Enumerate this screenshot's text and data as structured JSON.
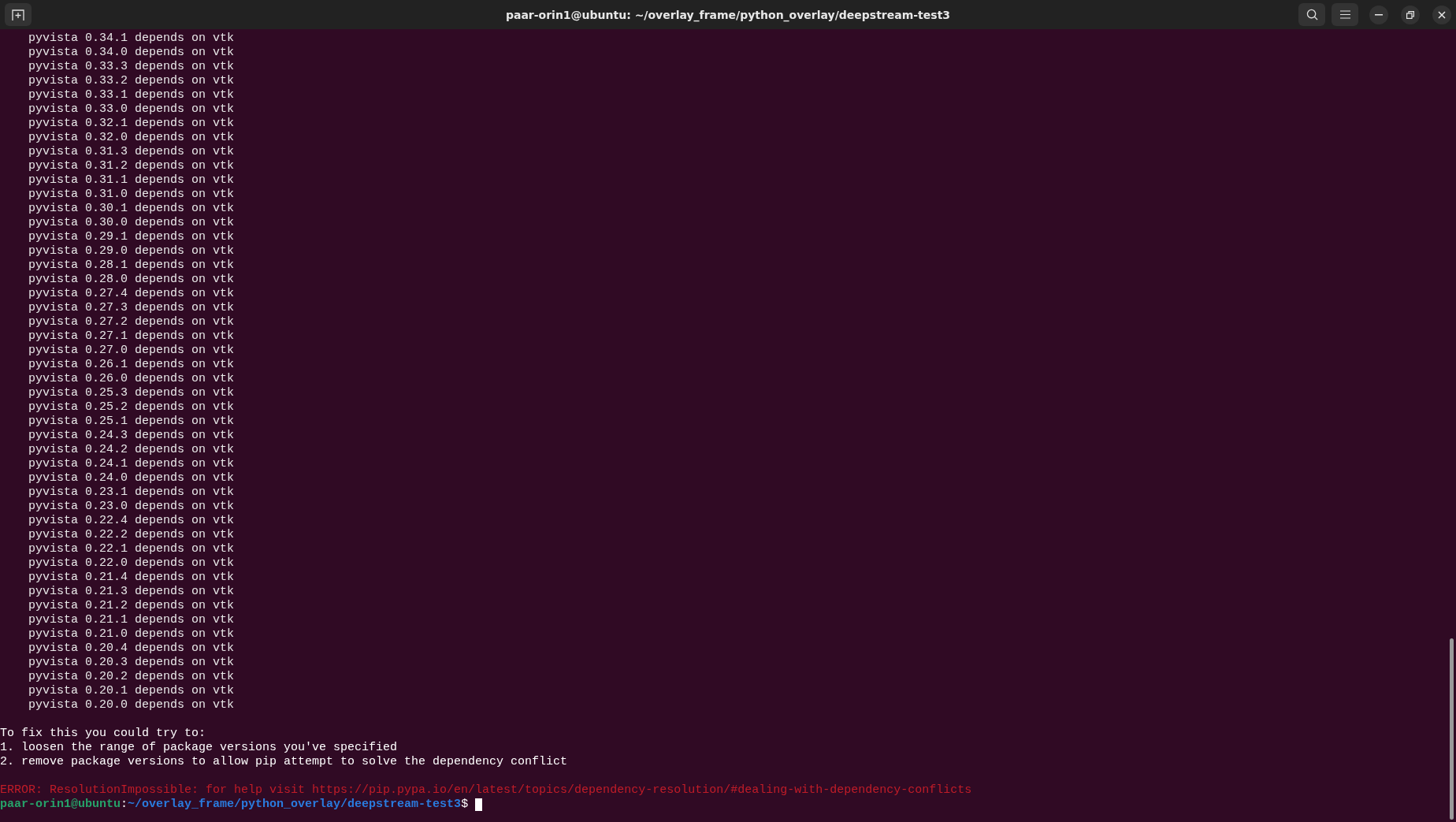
{
  "window": {
    "title": "paar-orin1@ubuntu: ~/overlay_frame/python_overlay/deepstream-test3"
  },
  "terminal": {
    "lines": [
      {
        "kind": "indented",
        "text": "pyvista 0.34.1 depends on vtk"
      },
      {
        "kind": "indented",
        "text": "pyvista 0.34.0 depends on vtk"
      },
      {
        "kind": "indented",
        "text": "pyvista 0.33.3 depends on vtk"
      },
      {
        "kind": "indented",
        "text": "pyvista 0.33.2 depends on vtk"
      },
      {
        "kind": "indented",
        "text": "pyvista 0.33.1 depends on vtk"
      },
      {
        "kind": "indented",
        "text": "pyvista 0.33.0 depends on vtk"
      },
      {
        "kind": "indented",
        "text": "pyvista 0.32.1 depends on vtk"
      },
      {
        "kind": "indented",
        "text": "pyvista 0.32.0 depends on vtk"
      },
      {
        "kind": "indented",
        "text": "pyvista 0.31.3 depends on vtk"
      },
      {
        "kind": "indented",
        "text": "pyvista 0.31.2 depends on vtk"
      },
      {
        "kind": "indented",
        "text": "pyvista 0.31.1 depends on vtk"
      },
      {
        "kind": "indented",
        "text": "pyvista 0.31.0 depends on vtk"
      },
      {
        "kind": "indented",
        "text": "pyvista 0.30.1 depends on vtk"
      },
      {
        "kind": "indented",
        "text": "pyvista 0.30.0 depends on vtk"
      },
      {
        "kind": "indented",
        "text": "pyvista 0.29.1 depends on vtk"
      },
      {
        "kind": "indented",
        "text": "pyvista 0.29.0 depends on vtk"
      },
      {
        "kind": "indented",
        "text": "pyvista 0.28.1 depends on vtk"
      },
      {
        "kind": "indented",
        "text": "pyvista 0.28.0 depends on vtk"
      },
      {
        "kind": "indented",
        "text": "pyvista 0.27.4 depends on vtk"
      },
      {
        "kind": "indented",
        "text": "pyvista 0.27.3 depends on vtk"
      },
      {
        "kind": "indented",
        "text": "pyvista 0.27.2 depends on vtk"
      },
      {
        "kind": "indented",
        "text": "pyvista 0.27.1 depends on vtk"
      },
      {
        "kind": "indented",
        "text": "pyvista 0.27.0 depends on vtk"
      },
      {
        "kind": "indented",
        "text": "pyvista 0.26.1 depends on vtk"
      },
      {
        "kind": "indented",
        "text": "pyvista 0.26.0 depends on vtk"
      },
      {
        "kind": "indented",
        "text": "pyvista 0.25.3 depends on vtk"
      },
      {
        "kind": "indented",
        "text": "pyvista 0.25.2 depends on vtk"
      },
      {
        "kind": "indented",
        "text": "pyvista 0.25.1 depends on vtk"
      },
      {
        "kind": "indented",
        "text": "pyvista 0.24.3 depends on vtk"
      },
      {
        "kind": "indented",
        "text": "pyvista 0.24.2 depends on vtk"
      },
      {
        "kind": "indented",
        "text": "pyvista 0.24.1 depends on vtk"
      },
      {
        "kind": "indented",
        "text": "pyvista 0.24.0 depends on vtk"
      },
      {
        "kind": "indented",
        "text": "pyvista 0.23.1 depends on vtk"
      },
      {
        "kind": "indented",
        "text": "pyvista 0.23.0 depends on vtk"
      },
      {
        "kind": "indented",
        "text": "pyvista 0.22.4 depends on vtk"
      },
      {
        "kind": "indented",
        "text": "pyvista 0.22.2 depends on vtk"
      },
      {
        "kind": "indented",
        "text": "pyvista 0.22.1 depends on vtk"
      },
      {
        "kind": "indented",
        "text": "pyvista 0.22.0 depends on vtk"
      },
      {
        "kind": "indented",
        "text": "pyvista 0.21.4 depends on vtk"
      },
      {
        "kind": "indented",
        "text": "pyvista 0.21.3 depends on vtk"
      },
      {
        "kind": "indented",
        "text": "pyvista 0.21.2 depends on vtk"
      },
      {
        "kind": "indented",
        "text": "pyvista 0.21.1 depends on vtk"
      },
      {
        "kind": "indented",
        "text": "pyvista 0.21.0 depends on vtk"
      },
      {
        "kind": "indented",
        "text": "pyvista 0.20.4 depends on vtk"
      },
      {
        "kind": "indented",
        "text": "pyvista 0.20.3 depends on vtk"
      },
      {
        "kind": "indented",
        "text": "pyvista 0.20.2 depends on vtk"
      },
      {
        "kind": "indented",
        "text": "pyvista 0.20.1 depends on vtk"
      },
      {
        "kind": "indented",
        "text": "pyvista 0.20.0 depends on vtk"
      },
      {
        "kind": "blank"
      },
      {
        "kind": "plain",
        "text": "To fix this you could try to:"
      },
      {
        "kind": "plain",
        "text": "1. loosen the range of package versions you've specified"
      },
      {
        "kind": "plain",
        "text": "2. remove package versions to allow pip attempt to solve the dependency conflict"
      },
      {
        "kind": "blank"
      },
      {
        "kind": "error",
        "text": "ERROR: ResolutionImpossible: for help visit https://pip.pypa.io/en/latest/topics/dependency-resolution/#dealing-with-dependency-conflicts"
      }
    ],
    "prompt": {
      "user_host": "paar-orin1@ubuntu",
      "separator": ":",
      "path": "~/overlay_frame/python_overlay/deepstream-test3",
      "symbol": "$"
    }
  }
}
